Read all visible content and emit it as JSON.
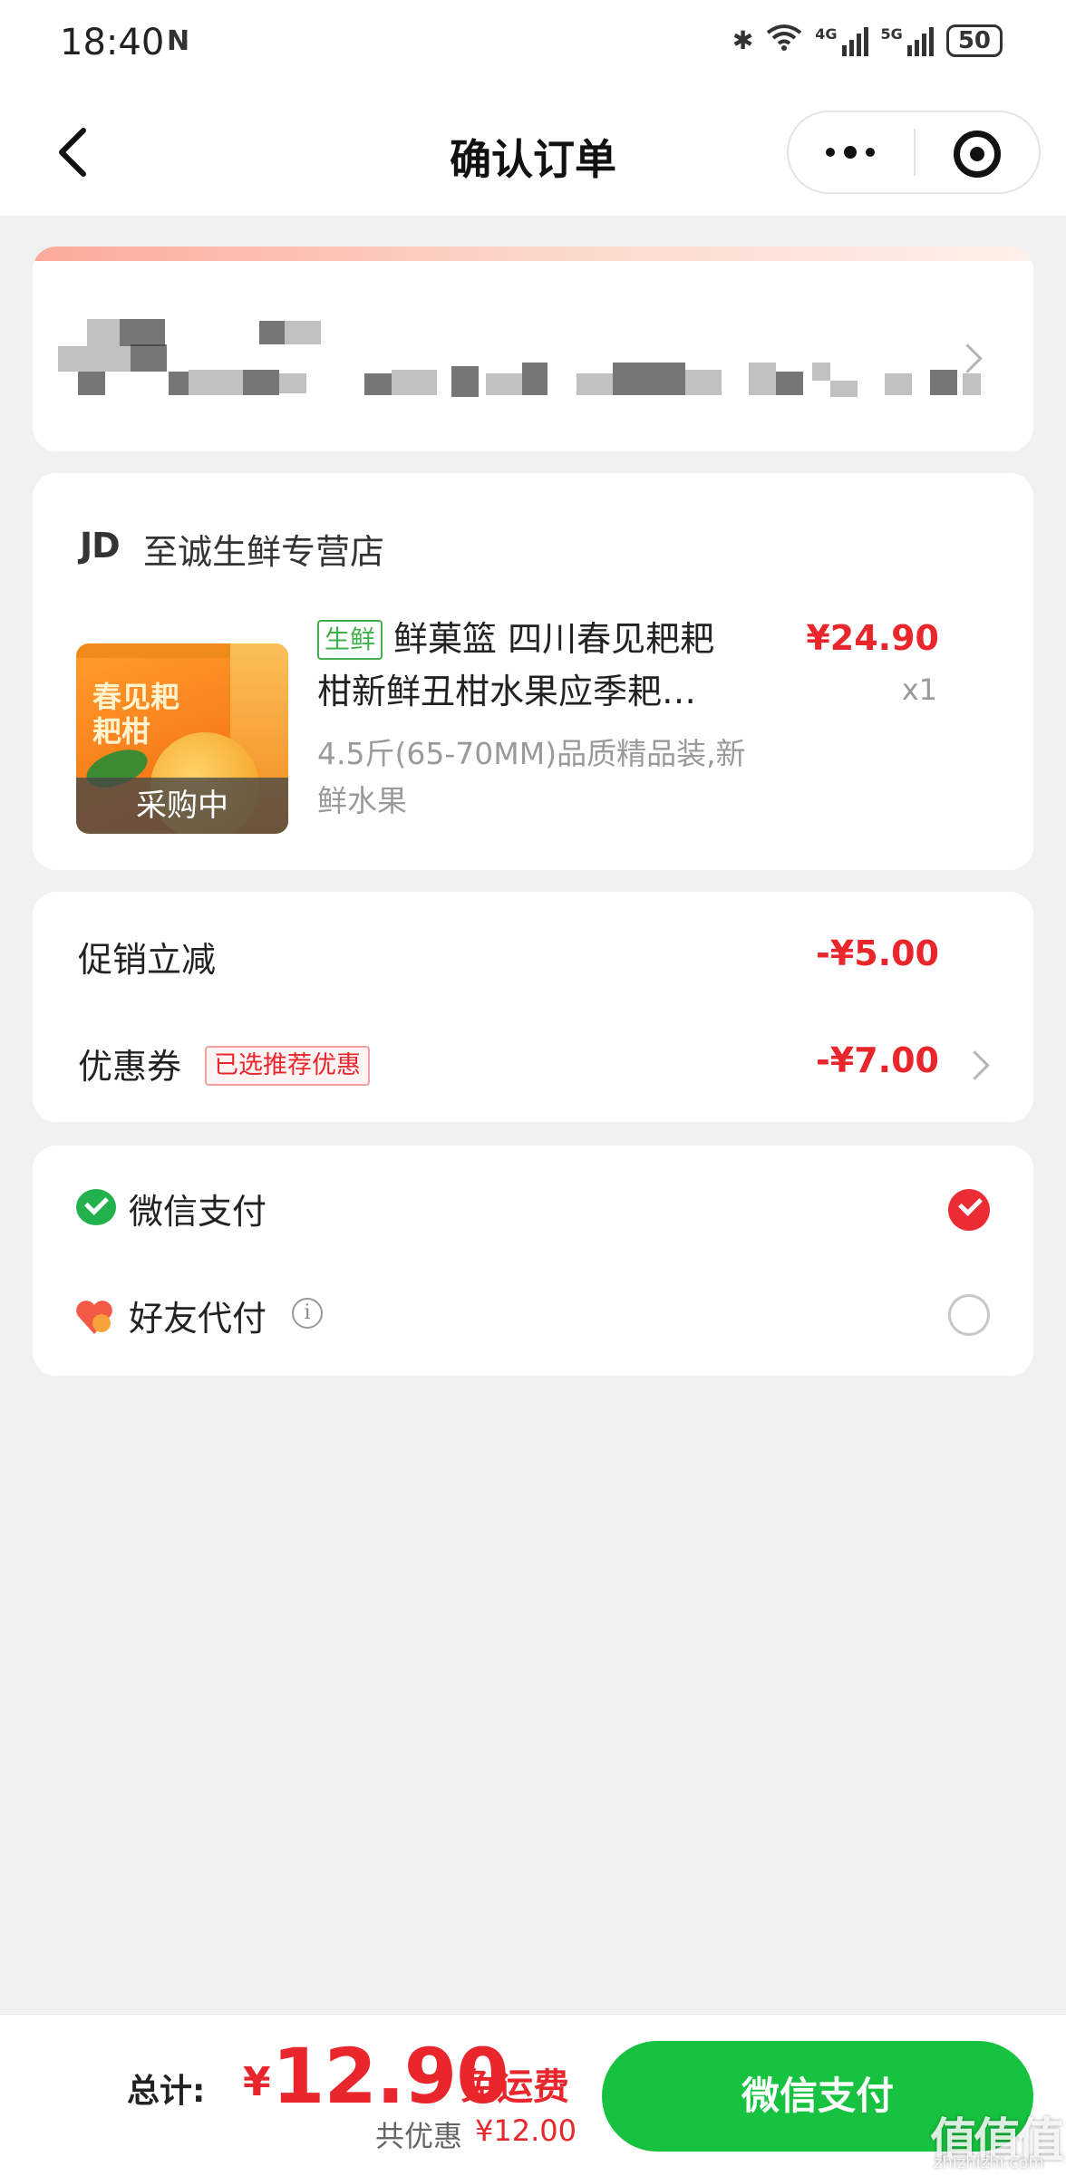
{
  "status_bar": {
    "time": "18:40",
    "nfc": "N",
    "net1": "4G",
    "net2": "5G",
    "battery": "50"
  },
  "nav": {
    "title": "确认订单",
    "more_icon": "more-dots-icon",
    "target_icon": "record-target-icon"
  },
  "shop": {
    "logo": "JD",
    "name": "至诚生鲜专营店"
  },
  "product": {
    "tag": "生鲜",
    "title_line1": "鲜菓篮 四川春见耙耙",
    "title_line2": "柑新鲜丑柑水果应季耙…",
    "spec": "4.5斤(65-70MM)品质精品装,新鲜水果",
    "price": "¥24.90",
    "quantity": "x1",
    "image_box_text": "春见耙耙柑",
    "image_overlay": "采购中"
  },
  "promotions": {
    "promo_label": "促销立减",
    "promo_amount": "-¥5.00",
    "coupon_label": "优惠券",
    "coupon_badge": "已选推荐优惠",
    "coupon_amount": "-¥7.00"
  },
  "payment": {
    "wechat_label": "微信支付",
    "friend_label": "好友代付",
    "info_glyph": "i"
  },
  "bottom": {
    "total_label": "总计:",
    "currency": "¥",
    "total_amount": "12.90",
    "free_shipping": "免运费",
    "saved_label": "共优惠",
    "saved_amount": "¥12.00",
    "pay_button": "微信支付"
  },
  "watermark": {
    "text": "值值值",
    "url": "zhizhizhi.com"
  },
  "colors": {
    "price_red": "#e8262c",
    "wechat_green": "#16c23f",
    "fresh_tag_green": "#3fb04a"
  }
}
